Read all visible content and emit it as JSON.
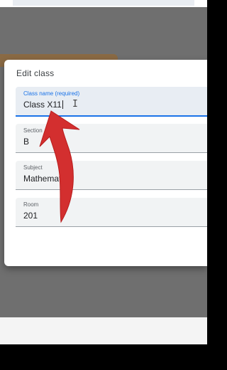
{
  "dialog": {
    "title": "Edit class",
    "fields": [
      {
        "label": "Class name (required)",
        "value": "Class X11"
      },
      {
        "label": "Section",
        "value": "B"
      },
      {
        "label": "Subject",
        "value": "Mathemat"
      },
      {
        "label": "Room",
        "value": "201"
      }
    ]
  },
  "colors": {
    "accent": "#1a73e8",
    "annotation_arrow": "#d32f2f",
    "backdrop": "#6f6f6f"
  },
  "icons": {
    "text_cursor": "ibeam-cursor-icon",
    "annotation": "red-arrow-annotation"
  }
}
